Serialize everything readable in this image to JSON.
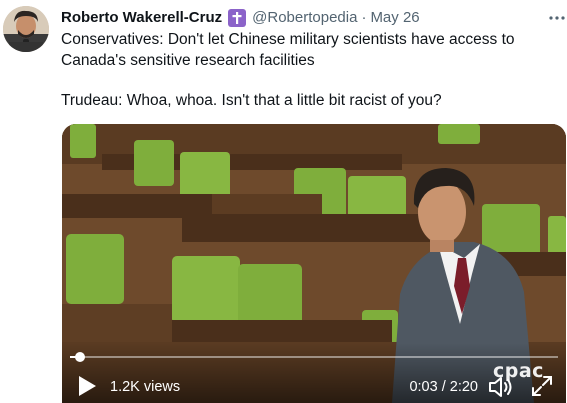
{
  "author": {
    "name": "Roberto Wakerell-Cruz",
    "handle": "@Robertopedia",
    "separator": "·",
    "date": "May 26",
    "badge_icon": "cross-icon",
    "badge_color": "#8b63c9"
  },
  "tweet": {
    "lines": [
      "Conservatives: Don't let Chinese military scientists have access to Canada's sensitive research facilities",
      "Trudeau: Whoa, whoa. Isn't that a little bit racist of you?"
    ]
  },
  "video": {
    "views": "1.2K views",
    "time": "0:03 / 2:20",
    "progress_fraction": 0.021,
    "watermark": "cpac",
    "scene_colors": {
      "wood": "#6e4a2c",
      "wood_dark": "#4a2f1b",
      "seat_green": "#7fae3c",
      "seat_green_dark": "#5e8a2a",
      "suit": "#4f5862",
      "tie": "#7b1d2a"
    }
  },
  "icons": {
    "more": "more-horizontal-icon",
    "play": "play-icon",
    "volume": "volume-icon",
    "fullscreen": "fullscreen-icon"
  }
}
